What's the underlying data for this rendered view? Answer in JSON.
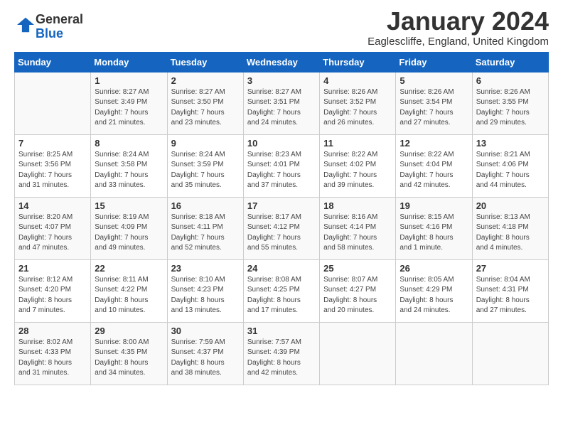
{
  "header": {
    "logo_line1": "General",
    "logo_line2": "Blue",
    "month": "January 2024",
    "location": "Eaglescliffe, England, United Kingdom"
  },
  "days_of_week": [
    "Sunday",
    "Monday",
    "Tuesday",
    "Wednesday",
    "Thursday",
    "Friday",
    "Saturday"
  ],
  "weeks": [
    [
      {
        "day": "",
        "info": ""
      },
      {
        "day": "1",
        "info": "Sunrise: 8:27 AM\nSunset: 3:49 PM\nDaylight: 7 hours\nand 21 minutes."
      },
      {
        "day": "2",
        "info": "Sunrise: 8:27 AM\nSunset: 3:50 PM\nDaylight: 7 hours\nand 23 minutes."
      },
      {
        "day": "3",
        "info": "Sunrise: 8:27 AM\nSunset: 3:51 PM\nDaylight: 7 hours\nand 24 minutes."
      },
      {
        "day": "4",
        "info": "Sunrise: 8:26 AM\nSunset: 3:52 PM\nDaylight: 7 hours\nand 26 minutes."
      },
      {
        "day": "5",
        "info": "Sunrise: 8:26 AM\nSunset: 3:54 PM\nDaylight: 7 hours\nand 27 minutes."
      },
      {
        "day": "6",
        "info": "Sunrise: 8:26 AM\nSunset: 3:55 PM\nDaylight: 7 hours\nand 29 minutes."
      }
    ],
    [
      {
        "day": "7",
        "info": "Sunrise: 8:25 AM\nSunset: 3:56 PM\nDaylight: 7 hours\nand 31 minutes."
      },
      {
        "day": "8",
        "info": "Sunrise: 8:24 AM\nSunset: 3:58 PM\nDaylight: 7 hours\nand 33 minutes."
      },
      {
        "day": "9",
        "info": "Sunrise: 8:24 AM\nSunset: 3:59 PM\nDaylight: 7 hours\nand 35 minutes."
      },
      {
        "day": "10",
        "info": "Sunrise: 8:23 AM\nSunset: 4:01 PM\nDaylight: 7 hours\nand 37 minutes."
      },
      {
        "day": "11",
        "info": "Sunrise: 8:22 AM\nSunset: 4:02 PM\nDaylight: 7 hours\nand 39 minutes."
      },
      {
        "day": "12",
        "info": "Sunrise: 8:22 AM\nSunset: 4:04 PM\nDaylight: 7 hours\nand 42 minutes."
      },
      {
        "day": "13",
        "info": "Sunrise: 8:21 AM\nSunset: 4:06 PM\nDaylight: 7 hours\nand 44 minutes."
      }
    ],
    [
      {
        "day": "14",
        "info": "Sunrise: 8:20 AM\nSunset: 4:07 PM\nDaylight: 7 hours\nand 47 minutes."
      },
      {
        "day": "15",
        "info": "Sunrise: 8:19 AM\nSunset: 4:09 PM\nDaylight: 7 hours\nand 49 minutes."
      },
      {
        "day": "16",
        "info": "Sunrise: 8:18 AM\nSunset: 4:11 PM\nDaylight: 7 hours\nand 52 minutes."
      },
      {
        "day": "17",
        "info": "Sunrise: 8:17 AM\nSunset: 4:12 PM\nDaylight: 7 hours\nand 55 minutes."
      },
      {
        "day": "18",
        "info": "Sunrise: 8:16 AM\nSunset: 4:14 PM\nDaylight: 7 hours\nand 58 minutes."
      },
      {
        "day": "19",
        "info": "Sunrise: 8:15 AM\nSunset: 4:16 PM\nDaylight: 8 hours\nand 1 minute."
      },
      {
        "day": "20",
        "info": "Sunrise: 8:13 AM\nSunset: 4:18 PM\nDaylight: 8 hours\nand 4 minutes."
      }
    ],
    [
      {
        "day": "21",
        "info": "Sunrise: 8:12 AM\nSunset: 4:20 PM\nDaylight: 8 hours\nand 7 minutes."
      },
      {
        "day": "22",
        "info": "Sunrise: 8:11 AM\nSunset: 4:22 PM\nDaylight: 8 hours\nand 10 minutes."
      },
      {
        "day": "23",
        "info": "Sunrise: 8:10 AM\nSunset: 4:23 PM\nDaylight: 8 hours\nand 13 minutes."
      },
      {
        "day": "24",
        "info": "Sunrise: 8:08 AM\nSunset: 4:25 PM\nDaylight: 8 hours\nand 17 minutes."
      },
      {
        "day": "25",
        "info": "Sunrise: 8:07 AM\nSunset: 4:27 PM\nDaylight: 8 hours\nand 20 minutes."
      },
      {
        "day": "26",
        "info": "Sunrise: 8:05 AM\nSunset: 4:29 PM\nDaylight: 8 hours\nand 24 minutes."
      },
      {
        "day": "27",
        "info": "Sunrise: 8:04 AM\nSunset: 4:31 PM\nDaylight: 8 hours\nand 27 minutes."
      }
    ],
    [
      {
        "day": "28",
        "info": "Sunrise: 8:02 AM\nSunset: 4:33 PM\nDaylight: 8 hours\nand 31 minutes."
      },
      {
        "day": "29",
        "info": "Sunrise: 8:00 AM\nSunset: 4:35 PM\nDaylight: 8 hours\nand 34 minutes."
      },
      {
        "day": "30",
        "info": "Sunrise: 7:59 AM\nSunset: 4:37 PM\nDaylight: 8 hours\nand 38 minutes."
      },
      {
        "day": "31",
        "info": "Sunrise: 7:57 AM\nSunset: 4:39 PM\nDaylight: 8 hours\nand 42 minutes."
      },
      {
        "day": "",
        "info": ""
      },
      {
        "day": "",
        "info": ""
      },
      {
        "day": "",
        "info": ""
      }
    ]
  ]
}
